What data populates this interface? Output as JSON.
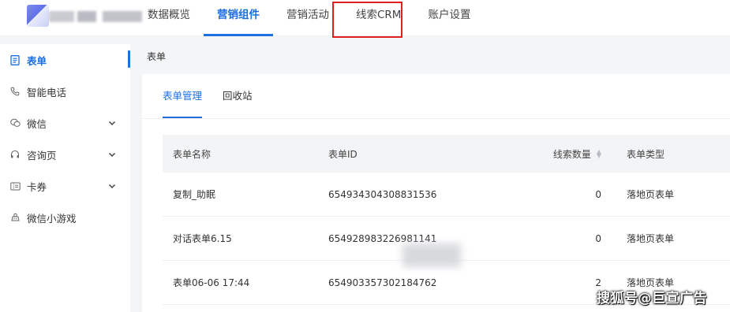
{
  "topnav": {
    "tabs": [
      {
        "label": "数据概览"
      },
      {
        "label": "营销组件"
      },
      {
        "label": "营销活动"
      },
      {
        "label": "线索CRM"
      },
      {
        "label": "账户设置"
      }
    ],
    "active_index": 1,
    "highlighted_index": 3
  },
  "sidebar": {
    "items": [
      {
        "label": "表单",
        "icon": "form-icon",
        "expandable": false
      },
      {
        "label": "智能电话",
        "icon": "phone-icon",
        "expandable": false
      },
      {
        "label": "微信",
        "icon": "wechat-icon",
        "expandable": true
      },
      {
        "label": "咨询页",
        "icon": "headset-icon",
        "expandable": true
      },
      {
        "label": "卡券",
        "icon": "coupon-icon",
        "expandable": true
      },
      {
        "label": "微信小游戏",
        "icon": "game-icon",
        "expandable": false
      }
    ],
    "active_index": 0
  },
  "main": {
    "breadcrumb": "表单",
    "subtabs": [
      {
        "label": "表单管理"
      },
      {
        "label": "回收站"
      }
    ],
    "active_subtab": 0,
    "table": {
      "columns": [
        "表单名称",
        "表单ID",
        "线索数量",
        "表单类型"
      ],
      "rows": [
        {
          "name": "复制_助眠",
          "id": "654934304308831536",
          "count": "0",
          "type": "落地页表单"
        },
        {
          "name": "对话表单6.15",
          "id": "654928983226981141",
          "count": "0",
          "type": "落地页表单"
        },
        {
          "name": "表单06-06 17:44",
          "id": "654903357302184762",
          "count": "2",
          "type": "落地页表单"
        }
      ]
    }
  },
  "watermark": "搜狐号@巨宣广告",
  "colors": {
    "accent": "#1d6fe0",
    "highlight": "#e02020"
  }
}
